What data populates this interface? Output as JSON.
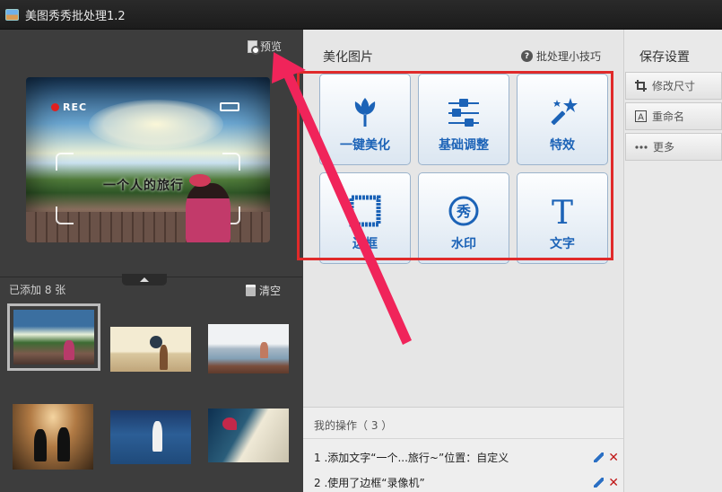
{
  "window": {
    "title": "美图秀秀批处理1.2"
  },
  "preview": {
    "label": "预览",
    "photo_caption": "一个人的旅行",
    "rec_label": "REC"
  },
  "gallery": {
    "added_label": "已添加 8 张",
    "clear_label": "清空",
    "thumb_count": 6
  },
  "beautify": {
    "title": "美化图片",
    "tips_label": "批处理小技巧",
    "tools": [
      {
        "label": "一键美化",
        "icon": "tulip-icon"
      },
      {
        "label": "基础调整",
        "icon": "sliders-icon"
      },
      {
        "label": "特效",
        "icon": "magic-wand-icon"
      },
      {
        "label": "边框",
        "icon": "frame-icon"
      },
      {
        "label": "水印",
        "icon": "watermark-icon"
      },
      {
        "label": "文字",
        "icon": "text-t-icon"
      }
    ]
  },
  "operations": {
    "title": "我的操作（ 3 ）",
    "items": [
      {
        "text": "1 .添加文字“一个...旅行~”位置：自定义"
      },
      {
        "text": "2 .使用了边框“录像机”"
      }
    ]
  },
  "save_settings": {
    "title": "保存设置",
    "buttons": [
      {
        "label": "修改尺寸",
        "icon": "crop-icon"
      },
      {
        "label": "重命名",
        "icon": "rename-icon"
      },
      {
        "label": "更多",
        "icon": "more-icon"
      }
    ]
  },
  "colors": {
    "accent_blue": "#1c63b7",
    "highlight_red": "#e02a2a",
    "arrow_pink": "#f0245a"
  }
}
